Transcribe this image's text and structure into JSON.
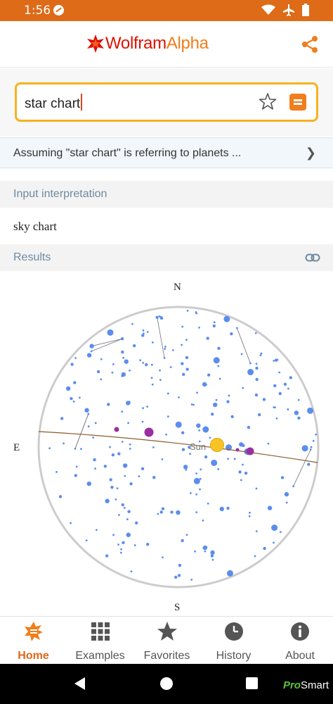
{
  "status_bar": {
    "time": "1:56"
  },
  "header": {
    "logo_main": "Wolfram",
    "logo_accent": "Alpha"
  },
  "search": {
    "query": "star chart"
  },
  "assumption": {
    "text": "Assuming \"star chart\" is  referring to planets ..."
  },
  "pods": {
    "input_title": "Input interpretation",
    "input_value": "sky chart",
    "results_title": "Results"
  },
  "sky_chart": {
    "north": "N",
    "south": "S",
    "east": "E",
    "sun_label": "Sun"
  },
  "bottom_nav": {
    "items": [
      {
        "label": "Home",
        "icon": "home-icon",
        "active": true
      },
      {
        "label": "Examples",
        "icon": "grid-icon",
        "active": false
      },
      {
        "label": "Favorites",
        "icon": "star-icon",
        "active": false
      },
      {
        "label": "History",
        "icon": "clock-icon",
        "active": false
      },
      {
        "label": "About",
        "icon": "info-icon",
        "active": false
      }
    ]
  },
  "watermark": {
    "pro": "Pro",
    "smart": "Smart"
  },
  "colors": {
    "status_bar": "#dd6b18",
    "accent": "#f07e1c",
    "star": "#5b8def",
    "planet": "#9b2fa0",
    "sun": "#f7c325"
  }
}
